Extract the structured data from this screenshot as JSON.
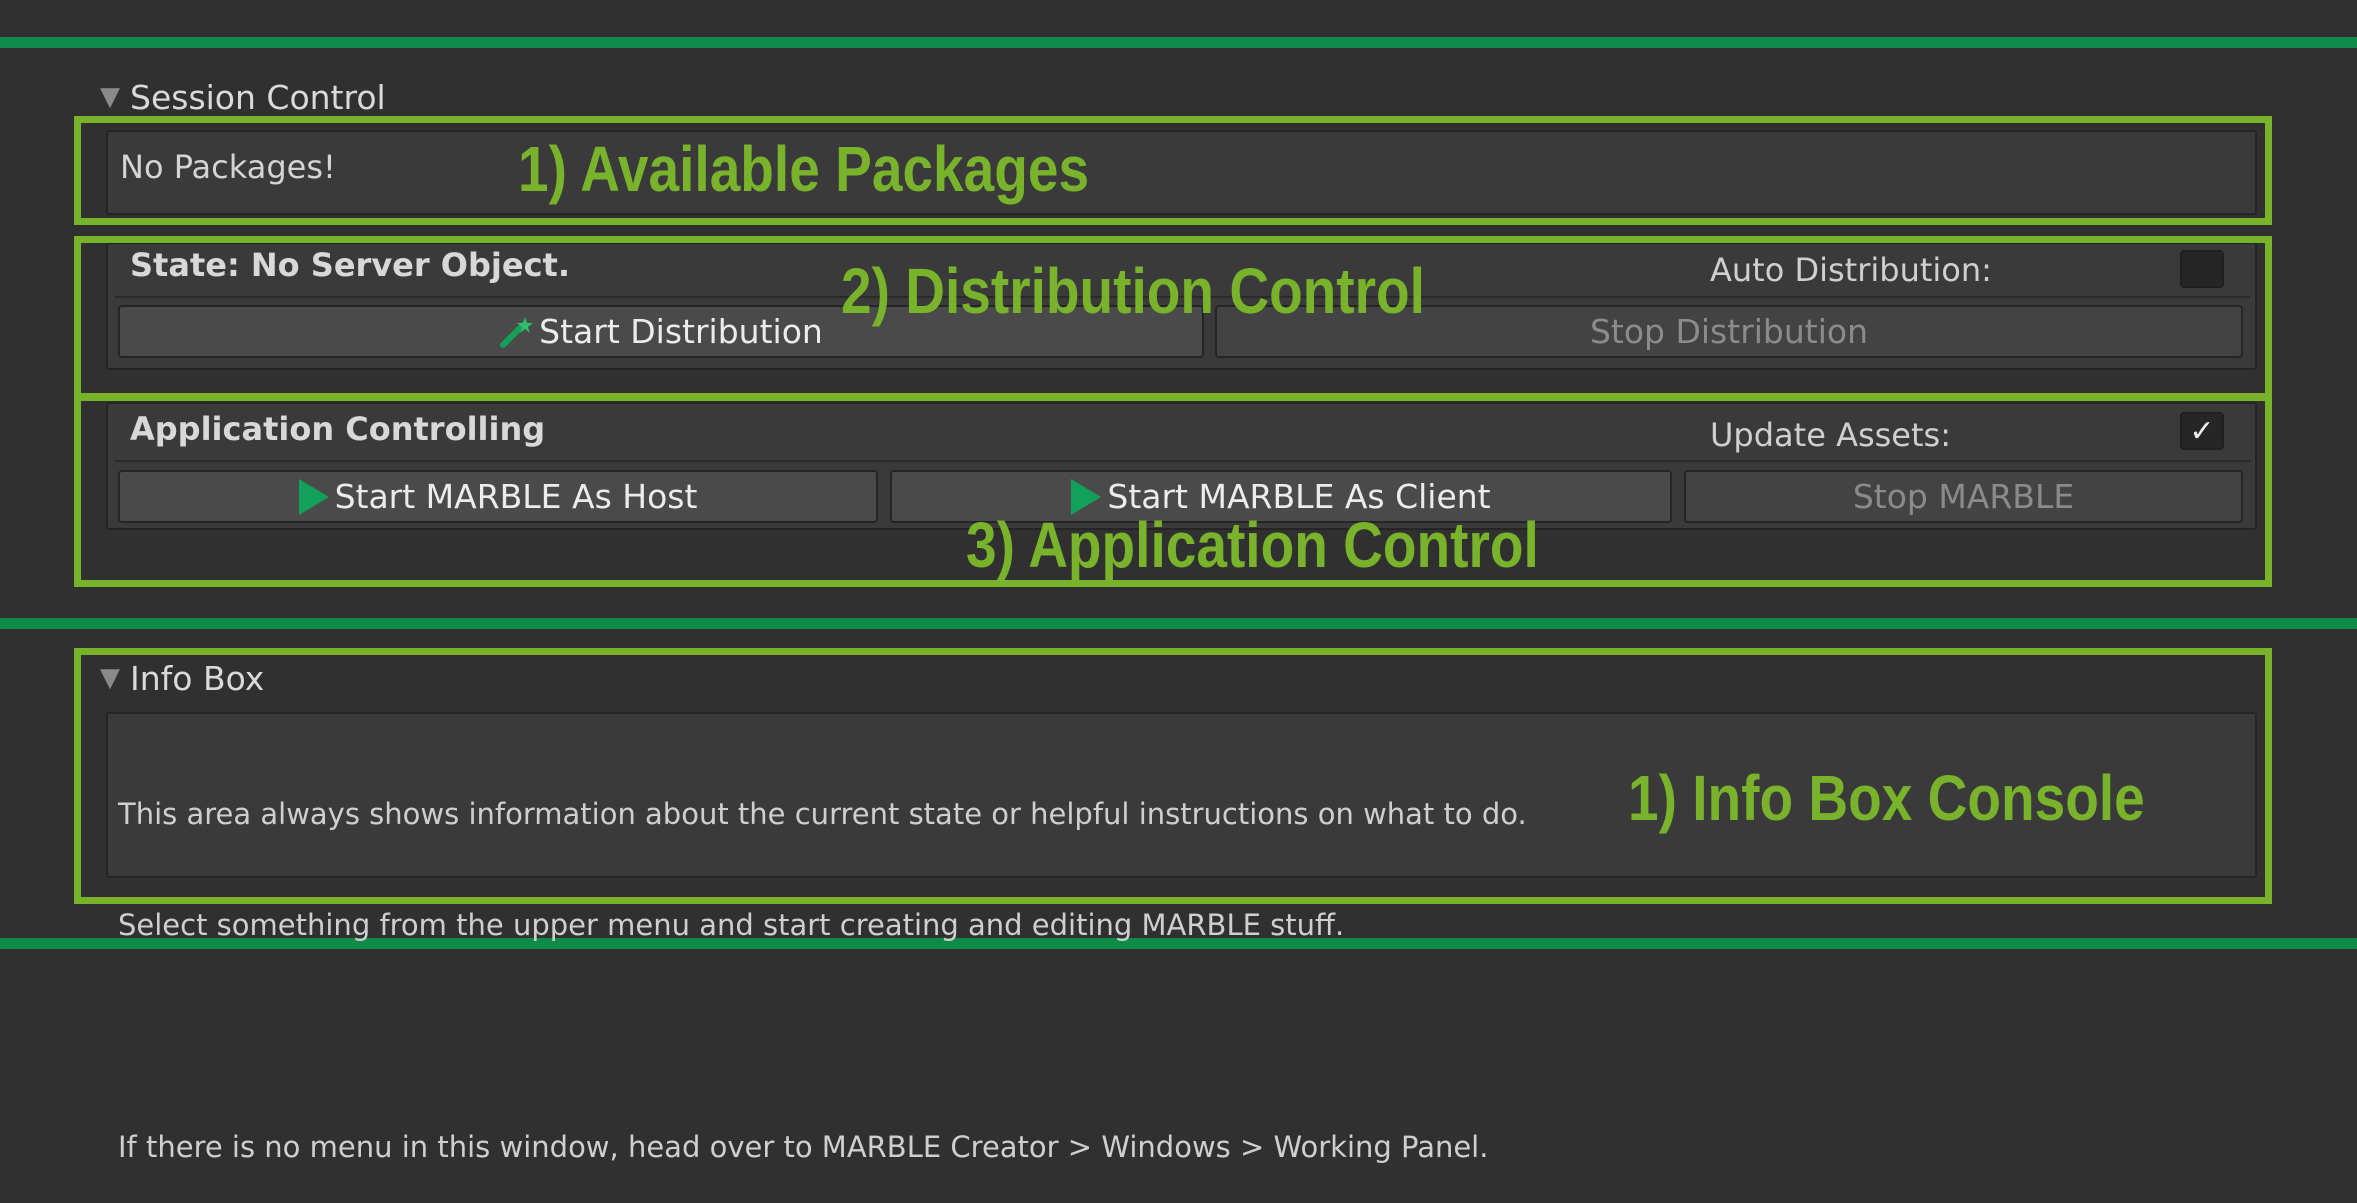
{
  "session_control": {
    "title": "Session Control",
    "packages": {
      "text": "No Packages!"
    },
    "distribution": {
      "state_label": "State: No Server Object.",
      "auto_label": "Auto Distribution:",
      "auto_checked": false,
      "start_label": "Start Distribution",
      "start_icon": "magic-wand-icon",
      "stop_label": "Stop Distribution"
    },
    "application": {
      "heading": "Application Controlling",
      "update_label": "Update Assets:",
      "update_checked": true,
      "host_label": "Start MARBLE As Host",
      "client_label": "Start MARBLE As Client",
      "stop_label": "Stop MARBLE",
      "play_icon": "play-icon"
    }
  },
  "info_box": {
    "title": "Info Box",
    "lines": [
      "This area always shows information about the current state or helpful instructions on what to do.",
      "Select something from the upper menu and start creating and editing MARBLE stuff.",
      "",
      "If there is no menu in this window, head over to MARBLE Creator > Windows > Working Panel."
    ]
  },
  "annotations": {
    "packages": "1) Available Packages",
    "distribution": "2) Distribution Control",
    "application": "3) Application Control",
    "info": "1) Info Box Console"
  },
  "colors": {
    "background": "#303030",
    "separator": "#0e8a49",
    "annotation": "#79b32b",
    "play": "#13a05a"
  }
}
